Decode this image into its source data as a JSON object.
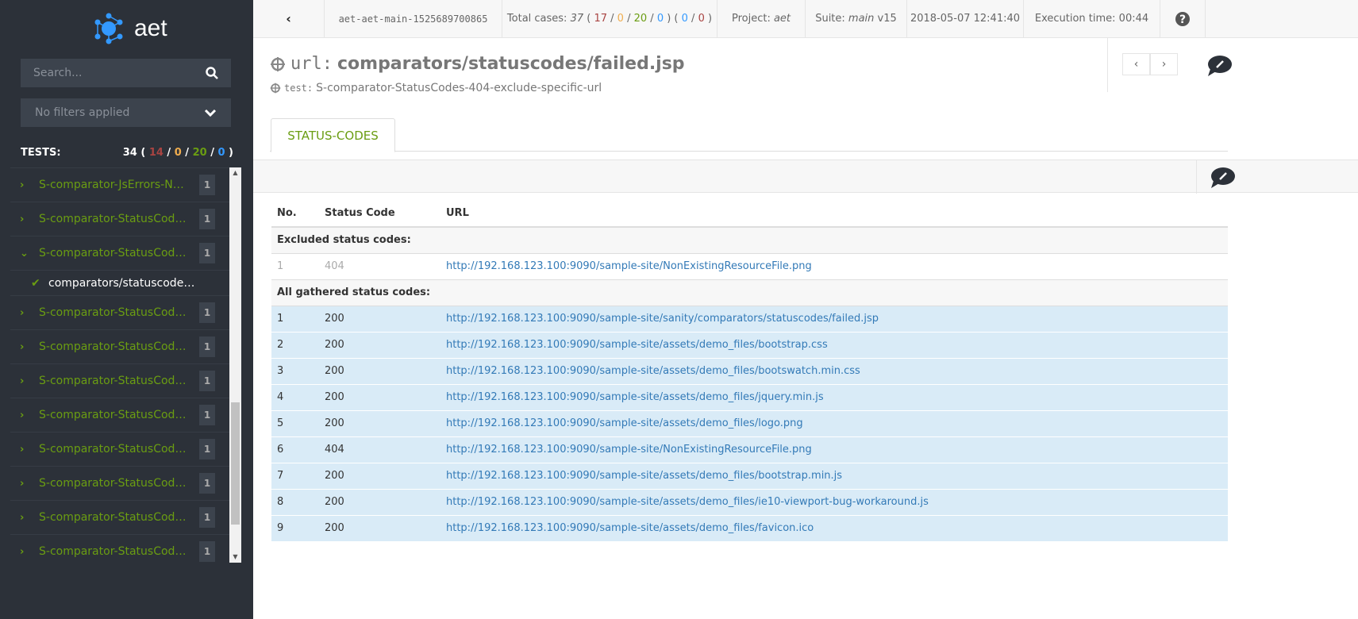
{
  "sidebar": {
    "logo": "aet",
    "search_placeholder": "Search...",
    "filter": "No filters applied",
    "tests_label": "TESTS:",
    "tests_total": "34",
    "tests_failed": "14",
    "tests_warning": "0",
    "tests_passed": "20",
    "tests_rebased": "0",
    "items": [
      {
        "label": "S-comparator-JsErrors-NO...",
        "count": "1",
        "expanded": false
      },
      {
        "label": "S-comparator-StatusCode...",
        "count": "1",
        "expanded": false
      },
      {
        "label": "S-comparator-StatusCode...",
        "count": "1",
        "expanded": true,
        "child": "comparators/statuscodes..."
      },
      {
        "label": "S-comparator-StatusCode...",
        "count": "1",
        "expanded": false
      },
      {
        "label": "S-comparator-StatusCode...",
        "count": "1",
        "expanded": false
      },
      {
        "label": "S-comparator-StatusCode...",
        "count": "1",
        "expanded": false
      },
      {
        "label": "S-comparator-StatusCode...",
        "count": "1",
        "expanded": false
      },
      {
        "label": "S-comparator-StatusCode...",
        "count": "1",
        "expanded": false
      },
      {
        "label": "S-comparator-StatusCode...",
        "count": "1",
        "expanded": false
      },
      {
        "label": "S-comparator-StatusCode...",
        "count": "1",
        "expanded": false
      },
      {
        "label": "S-comparator-StatusCode...",
        "count": "1",
        "expanded": false
      }
    ]
  },
  "topbar": {
    "suite_id": "aet-aet-main-1525689700865",
    "total_label": "Total cases:",
    "total": "37",
    "failed": "17",
    "warning": "0",
    "passed": "20",
    "rebased": "0",
    "extra1": "0",
    "extra2": "0",
    "project_label": "Project:",
    "project": "aet",
    "suite_label": "Suite:",
    "suite": "main",
    "version": "v15",
    "date": "2018-05-07 12:41:40",
    "exec_time": "Execution time: 00:44"
  },
  "header": {
    "url_key": "url:",
    "url": "comparators/statuscodes/failed.jsp",
    "test_key": "test:",
    "test": "S-comparator-StatusCodes-404-exclude-specific-url"
  },
  "tab": "STATUS-CODES",
  "table": {
    "columns": [
      "No.",
      "Status Code",
      "URL"
    ],
    "excluded_label": "Excluded status codes:",
    "excluded": [
      {
        "no": "1",
        "code": "404",
        "url": "http://192.168.123.100:9090/sample-site/NonExistingResourceFile.png"
      }
    ],
    "all_label": "All gathered status codes:",
    "rows": [
      {
        "no": "1",
        "code": "200",
        "url": "http://192.168.123.100:9090/sample-site/sanity/comparators/statuscodes/failed.jsp"
      },
      {
        "no": "2",
        "code": "200",
        "url": "http://192.168.123.100:9090/sample-site/assets/demo_files/bootstrap.css"
      },
      {
        "no": "3",
        "code": "200",
        "url": "http://192.168.123.100:9090/sample-site/assets/demo_files/bootswatch.min.css"
      },
      {
        "no": "4",
        "code": "200",
        "url": "http://192.168.123.100:9090/sample-site/assets/demo_files/jquery.min.js"
      },
      {
        "no": "5",
        "code": "200",
        "url": "http://192.168.123.100:9090/sample-site/assets/demo_files/logo.png"
      },
      {
        "no": "6",
        "code": "404",
        "url": "http://192.168.123.100:9090/sample-site/NonExistingResourceFile.png"
      },
      {
        "no": "7",
        "code": "200",
        "url": "http://192.168.123.100:9090/sample-site/assets/demo_files/bootstrap.min.js"
      },
      {
        "no": "8",
        "code": "200",
        "url": "http://192.168.123.100:9090/sample-site/assets/demo_files/ie10-viewport-bug-workaround.js"
      },
      {
        "no": "9",
        "code": "200",
        "url": "http://192.168.123.100:9090/sample-site/assets/demo_files/favicon.ico"
      }
    ]
  }
}
